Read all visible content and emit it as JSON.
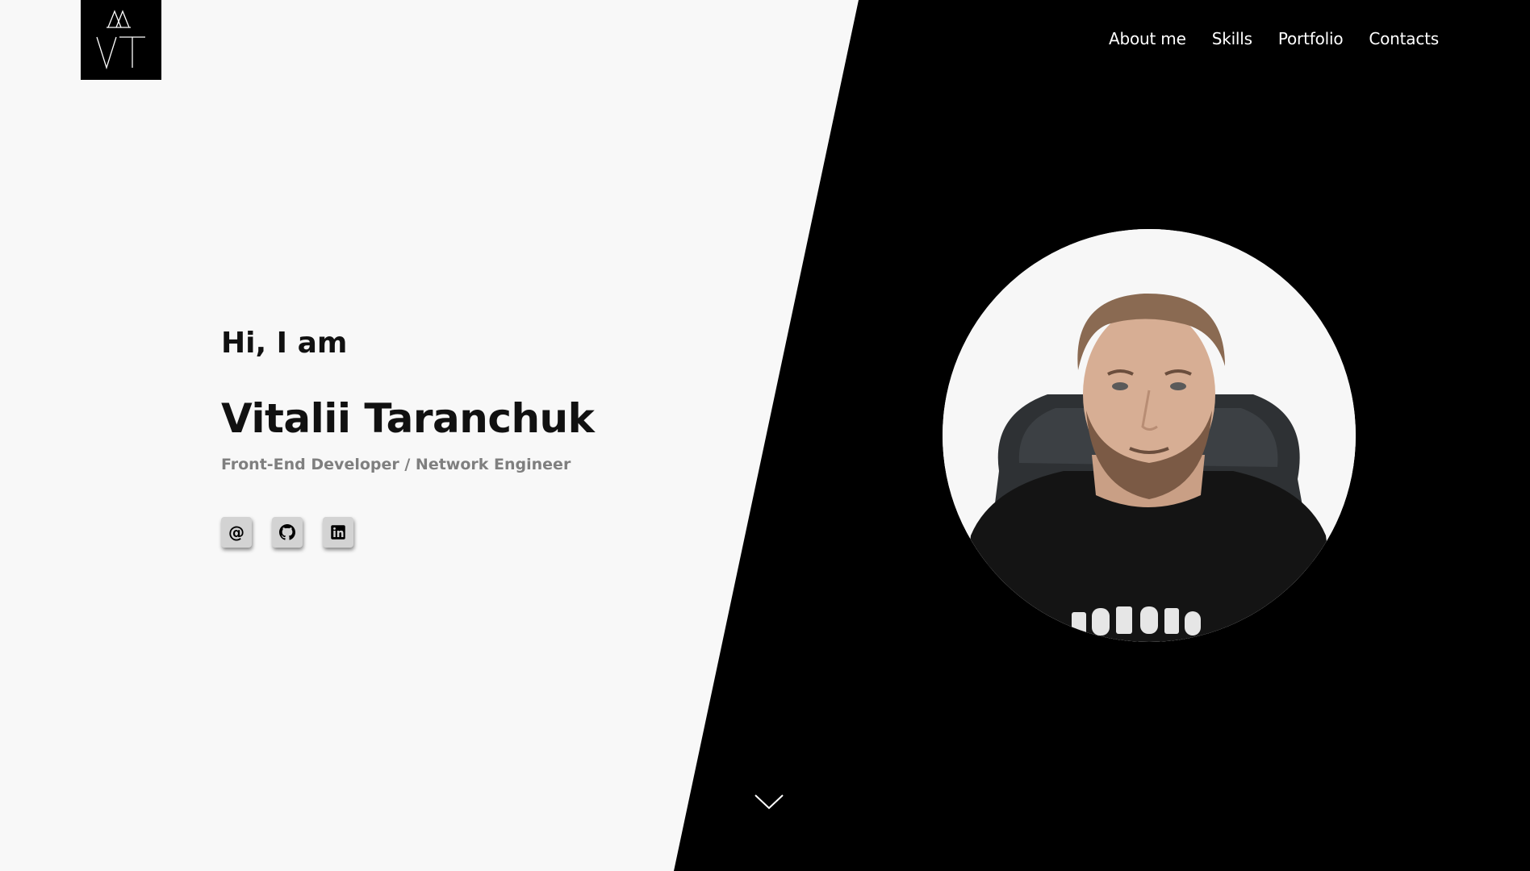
{
  "header": {
    "logo_icon": "vt-monogram-logo-icon",
    "nav": [
      {
        "label": "About me"
      },
      {
        "label": "Skills"
      },
      {
        "label": "Portfolio"
      },
      {
        "label": "Contacts"
      }
    ]
  },
  "hero": {
    "greeting": "Hi, I am",
    "name": "Vitalii Taranchuk",
    "role": "Front-End Developer / Network Engineer",
    "socials": [
      {
        "icon": "email-at-icon",
        "glyph": "@"
      },
      {
        "icon": "github-icon"
      },
      {
        "icon": "linkedin-icon"
      }
    ]
  },
  "profile": {
    "photo_icon": "profile-photo"
  },
  "scroll": {
    "icon": "chevron-down-icon"
  },
  "colors": {
    "background_light": "#f8f8f8",
    "background_dark": "#000000",
    "text_primary": "#111111",
    "text_muted": "#7f7f7f",
    "social_button": "#d3d3d3"
  }
}
